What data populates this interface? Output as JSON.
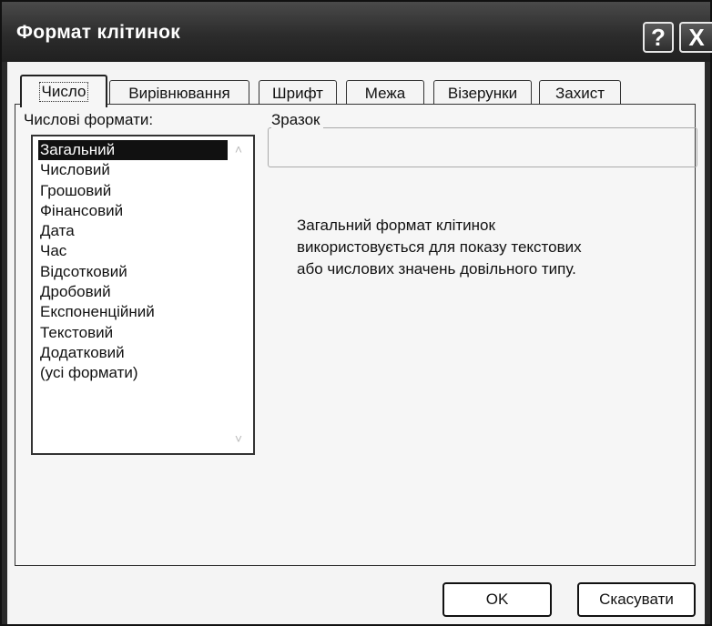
{
  "window": {
    "title": "Формат клітинок",
    "help_glyph": "?",
    "close_glyph": "X"
  },
  "tabs": [
    {
      "label": "Число",
      "active": true
    },
    {
      "label": "Вирівнювання",
      "active": false
    },
    {
      "label": "Шрифт",
      "active": false
    },
    {
      "label": "Межа",
      "active": false
    },
    {
      "label": "Візерунки",
      "active": false
    },
    {
      "label": "Захист",
      "active": false
    }
  ],
  "number_tab": {
    "formats_label": "Числові формати:",
    "formats": [
      "Загальний",
      "Числовий",
      "Грошовий",
      "Фінансовий",
      "Дата",
      "Час",
      "Відсотковий",
      "Дробовий",
      "Експоненційний",
      "Текстовий",
      "Додатковий",
      "(усі формати)"
    ],
    "selected_index": 0,
    "sample_label": "Зразок",
    "sample_value": "",
    "description_lines": [
      "Загальний формат клітинок",
      "використовується для показу текстових",
      "або числових значень довільного типу."
    ]
  },
  "buttons": {
    "ok": "OK",
    "cancel": "Скасувати"
  },
  "icons": {
    "help": "help-icon",
    "close": "close-icon",
    "scroll_up": "chevron-up-icon",
    "scroll_down": "chevron-down-icon"
  }
}
